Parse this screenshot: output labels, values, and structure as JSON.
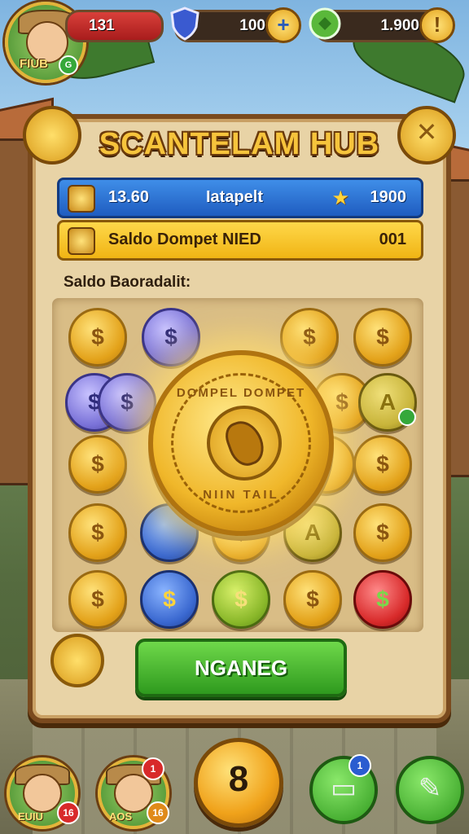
{
  "top_bar": {
    "player_label": "FIUB",
    "health_value": "131",
    "shield_value": "100",
    "gem_value": "1.900"
  },
  "panel": {
    "title": "SCANTELAM HUB",
    "blue_bar": {
      "left_value": "13.60",
      "center_text": "Iatapelt",
      "right_value": "1900"
    },
    "yellow_bar": {
      "label": "Saldo Dompet NIED",
      "value": "001"
    },
    "section_label": "Saldo Baoradalit:",
    "big_coin": {
      "ring_top": "DOMPEL DOMPET",
      "ring_bottom": "NIIN TAIL"
    },
    "coins": [
      {
        "color": "gold",
        "glyph": "$"
      },
      {
        "color": "purple",
        "glyph": "$"
      },
      {
        "color": "gold",
        "glyph": "$"
      },
      {
        "color": "gold",
        "glyph": "$"
      },
      {
        "color": "purple",
        "glyph": "$"
      },
      {
        "color": "purple",
        "glyph": "$"
      },
      {
        "color": "gold",
        "glyph": "$"
      },
      {
        "color": "olive",
        "glyph": "A"
      },
      {
        "color": "gold",
        "glyph": "$"
      },
      {
        "color": "gold",
        "glyph": "$"
      },
      {
        "color": "gold",
        "glyph": "$"
      },
      {
        "color": "gold",
        "glyph": "$"
      },
      {
        "color": "blue",
        "glyph": ""
      },
      {
        "color": "gold",
        "glyph": "$"
      },
      {
        "color": "olive",
        "glyph": "A"
      },
      {
        "color": "gold",
        "glyph": "$"
      },
      {
        "color": "gold",
        "glyph": "$"
      },
      {
        "color": "blue",
        "glyph": "$"
      },
      {
        "color": "green",
        "glyph": "$"
      },
      {
        "color": "gold",
        "glyph": "$"
      },
      {
        "color": "red",
        "glyph": "$"
      }
    ],
    "cta_label": "NGANEG"
  },
  "bottom_nav": {
    "left_avatar_label": "EUIU",
    "left_avatar_badge": "16",
    "second_avatar_label": "AOS",
    "second_avatar_badge": "16",
    "second_avatar_top_badge": "1",
    "center_symbol": "8",
    "inbox_badge": "1"
  }
}
